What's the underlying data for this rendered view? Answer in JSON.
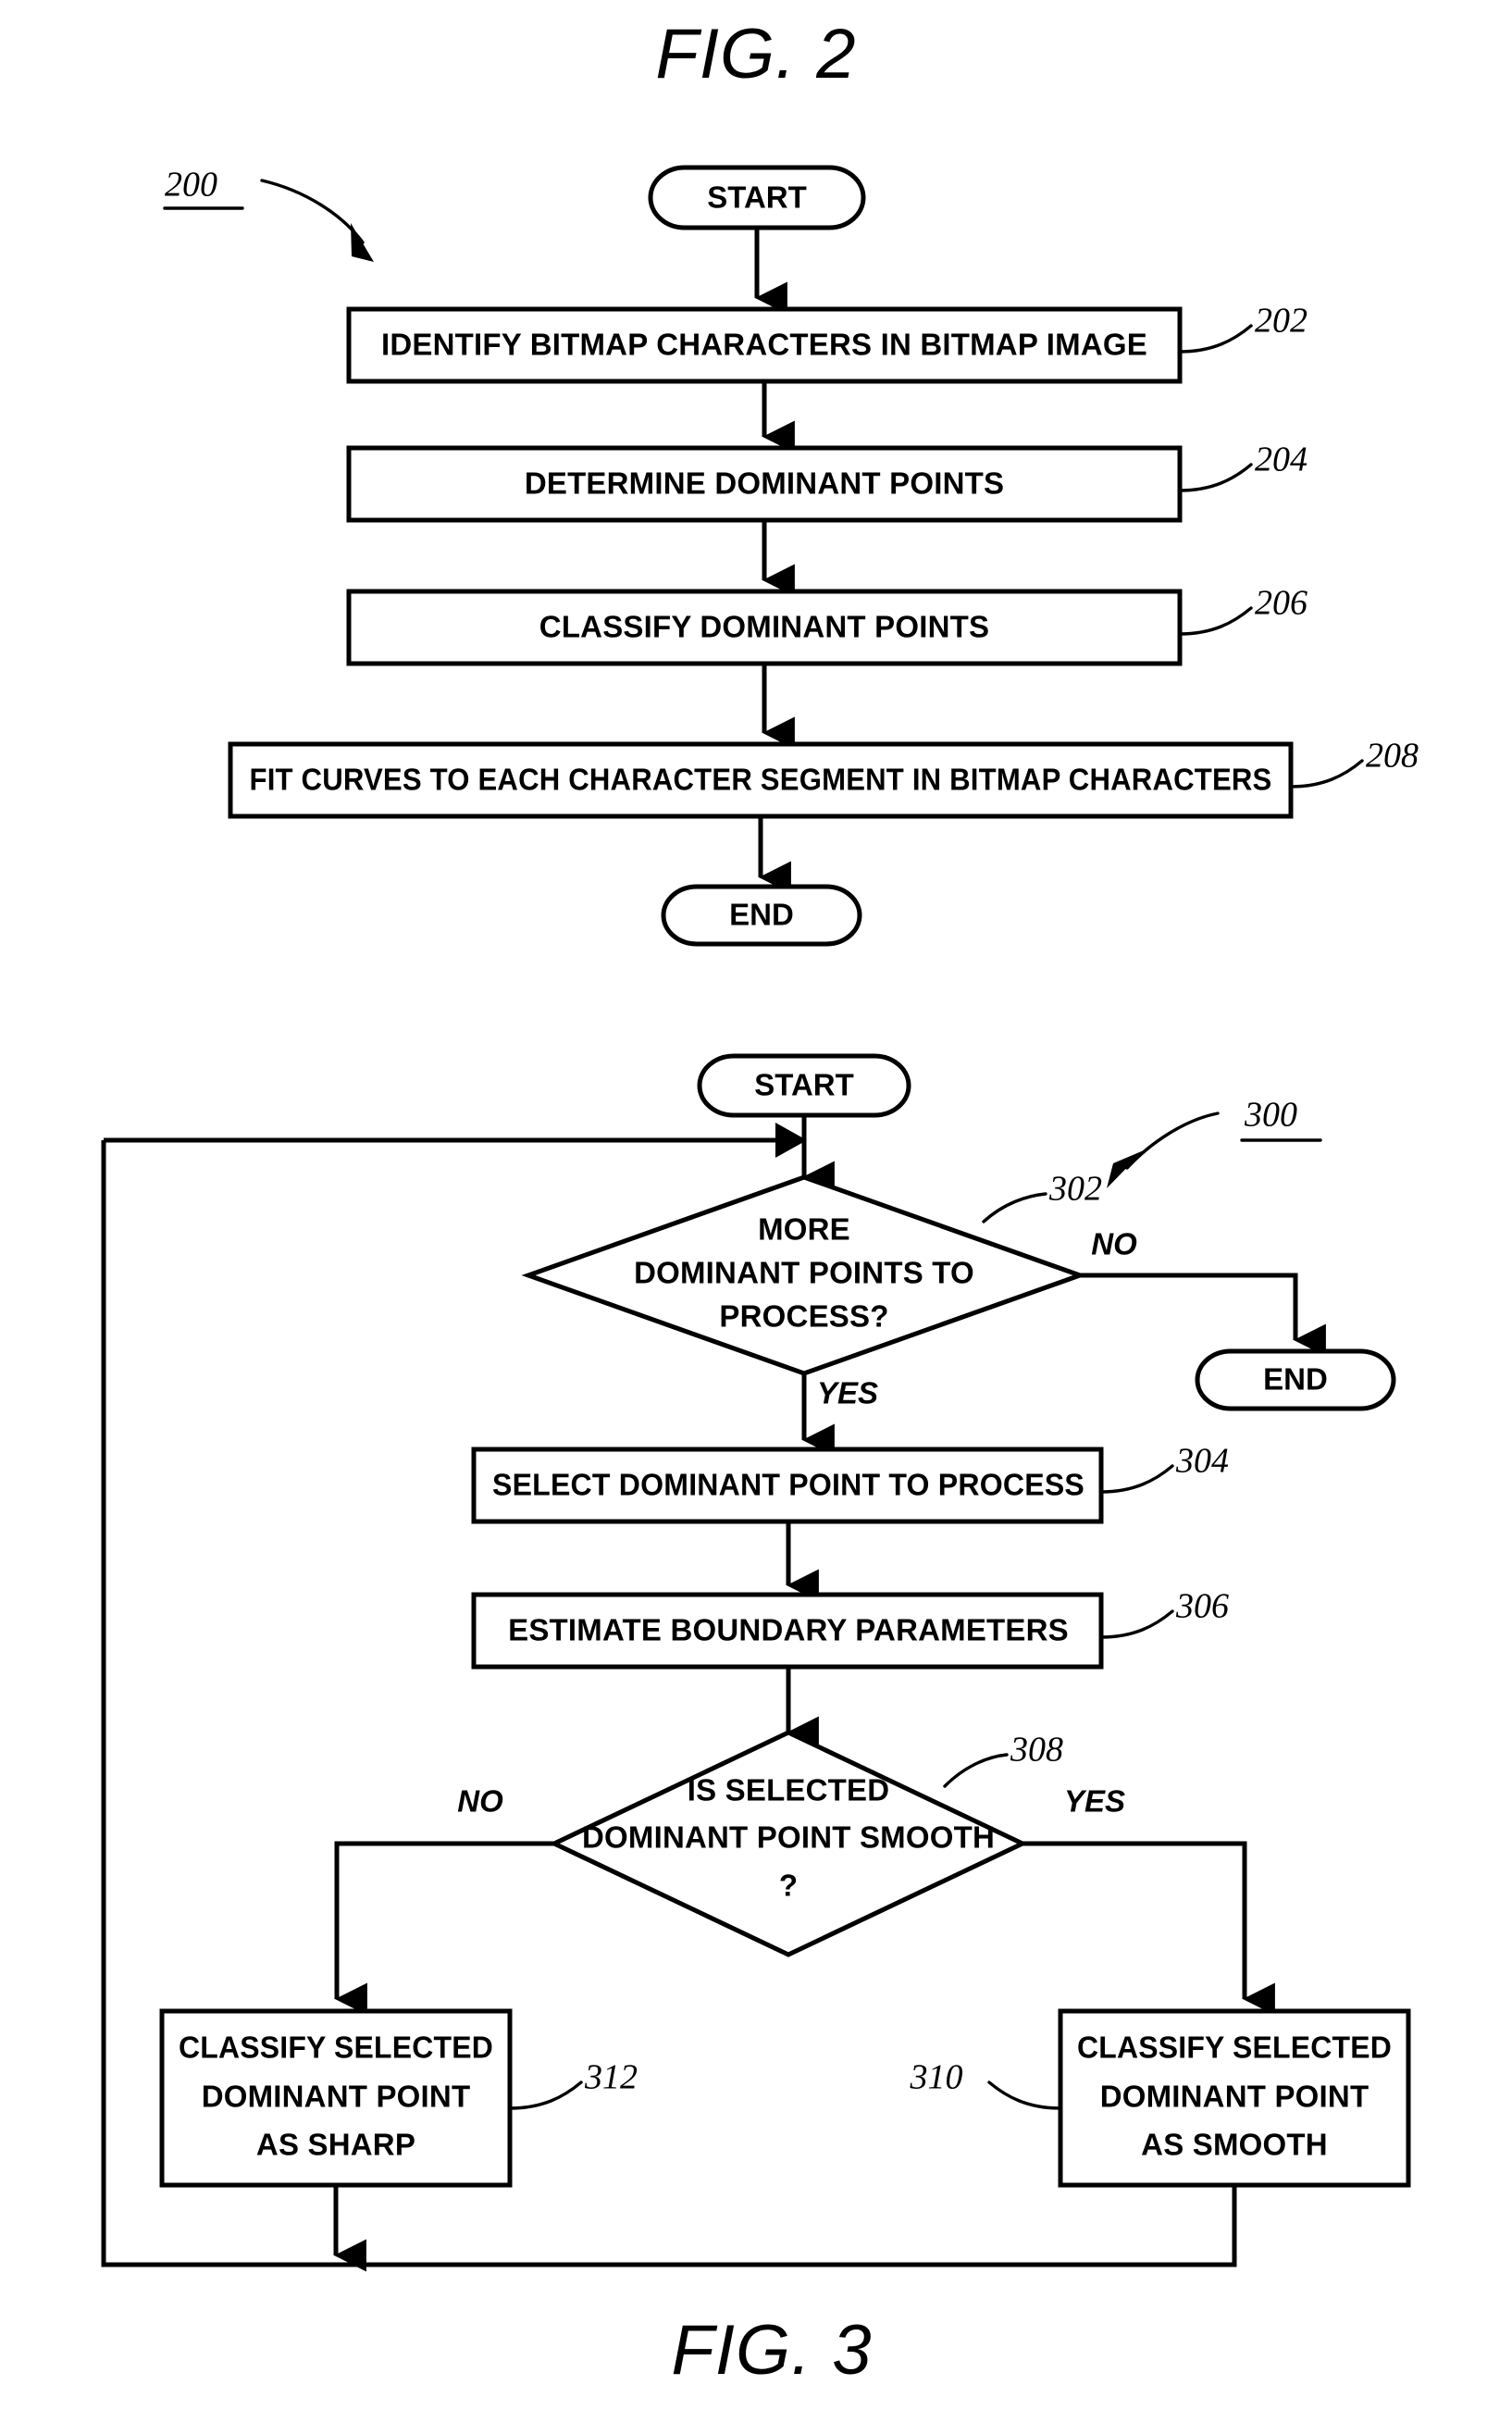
{
  "figures": [
    {
      "id": "fig2",
      "title": "FIG. 2",
      "diagram_ref": "200",
      "nodes": {
        "start": {
          "label": "START"
        },
        "s202": {
          "label": "IDENTIFY BITMAP CHARACTERS IN BITMAP IMAGE",
          "ref": "202"
        },
        "s204": {
          "label": "DETERMINE DOMINANT POINTS",
          "ref": "204"
        },
        "s206": {
          "label": "CLASSIFY DOMINANT POINTS",
          "ref": "206"
        },
        "s208": {
          "label": "FIT CURVES TO EACH CHARACTER SEGMENT IN BITMAP CHARACTERS",
          "ref": "208"
        },
        "end": {
          "label": "END"
        }
      }
    },
    {
      "id": "fig3",
      "title": "FIG. 3",
      "diagram_ref": "300",
      "nodes": {
        "start": {
          "label": "START"
        },
        "d302": {
          "ref": "302",
          "lines": [
            "MORE",
            "DOMINANT POINTS TO",
            "PROCESS?"
          ],
          "branch_no": "NO",
          "branch_yes": "YES"
        },
        "end": {
          "label": "END"
        },
        "s304": {
          "label": "SELECT DOMINANT POINT TO PROCESS",
          "ref": "304"
        },
        "s306": {
          "label": "ESTIMATE BOUNDARY PARAMETERS",
          "ref": "306"
        },
        "d308": {
          "ref": "308",
          "lines": [
            "IS SELECTED",
            "DOMINANT POINT SMOOTH",
            "?"
          ],
          "branch_no": "NO",
          "branch_yes": "YES"
        },
        "s312": {
          "ref": "312",
          "lines": [
            "CLASSIFY SELECTED",
            "DOMINANT POINT",
            "AS SHARP"
          ]
        },
        "s310": {
          "ref": "310",
          "lines": [
            "CLASSIFY SELECTED",
            "DOMINANT POINT",
            "AS SMOOTH"
          ]
        }
      }
    }
  ],
  "colors": {
    "ink": "#000000",
    "paper": "#ffffff"
  }
}
